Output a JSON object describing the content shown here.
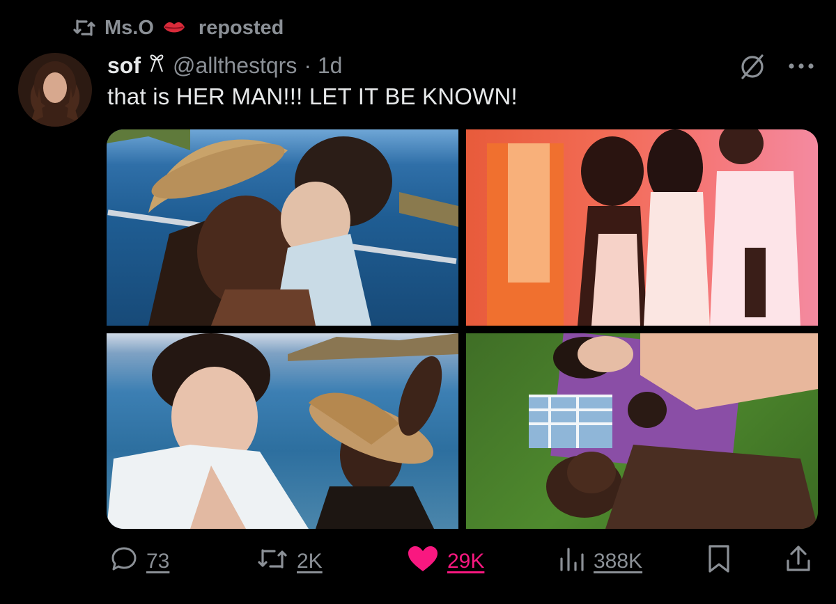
{
  "repost": {
    "user": "Ms.O",
    "label": "reposted",
    "icon": "repost-icon",
    "emoji_icon": "lips-icon"
  },
  "author": {
    "name": "sof",
    "badge_icon": "ribbon-icon",
    "handle": "@allthestqrs",
    "time": "· 1d"
  },
  "tweet": {
    "text": "that is HER MAN!!! LET IT BE KNOWN!"
  },
  "media": {
    "count": 4,
    "photos": [
      "photo-1",
      "photo-2",
      "photo-3",
      "photo-4"
    ]
  },
  "actions": {
    "replies": "73",
    "reposts": "2K",
    "likes": "29K",
    "views": "388K"
  },
  "colors": {
    "background": "#000000",
    "text": "#e7e9ea",
    "muted": "#8b9096",
    "like": "#f91880"
  }
}
